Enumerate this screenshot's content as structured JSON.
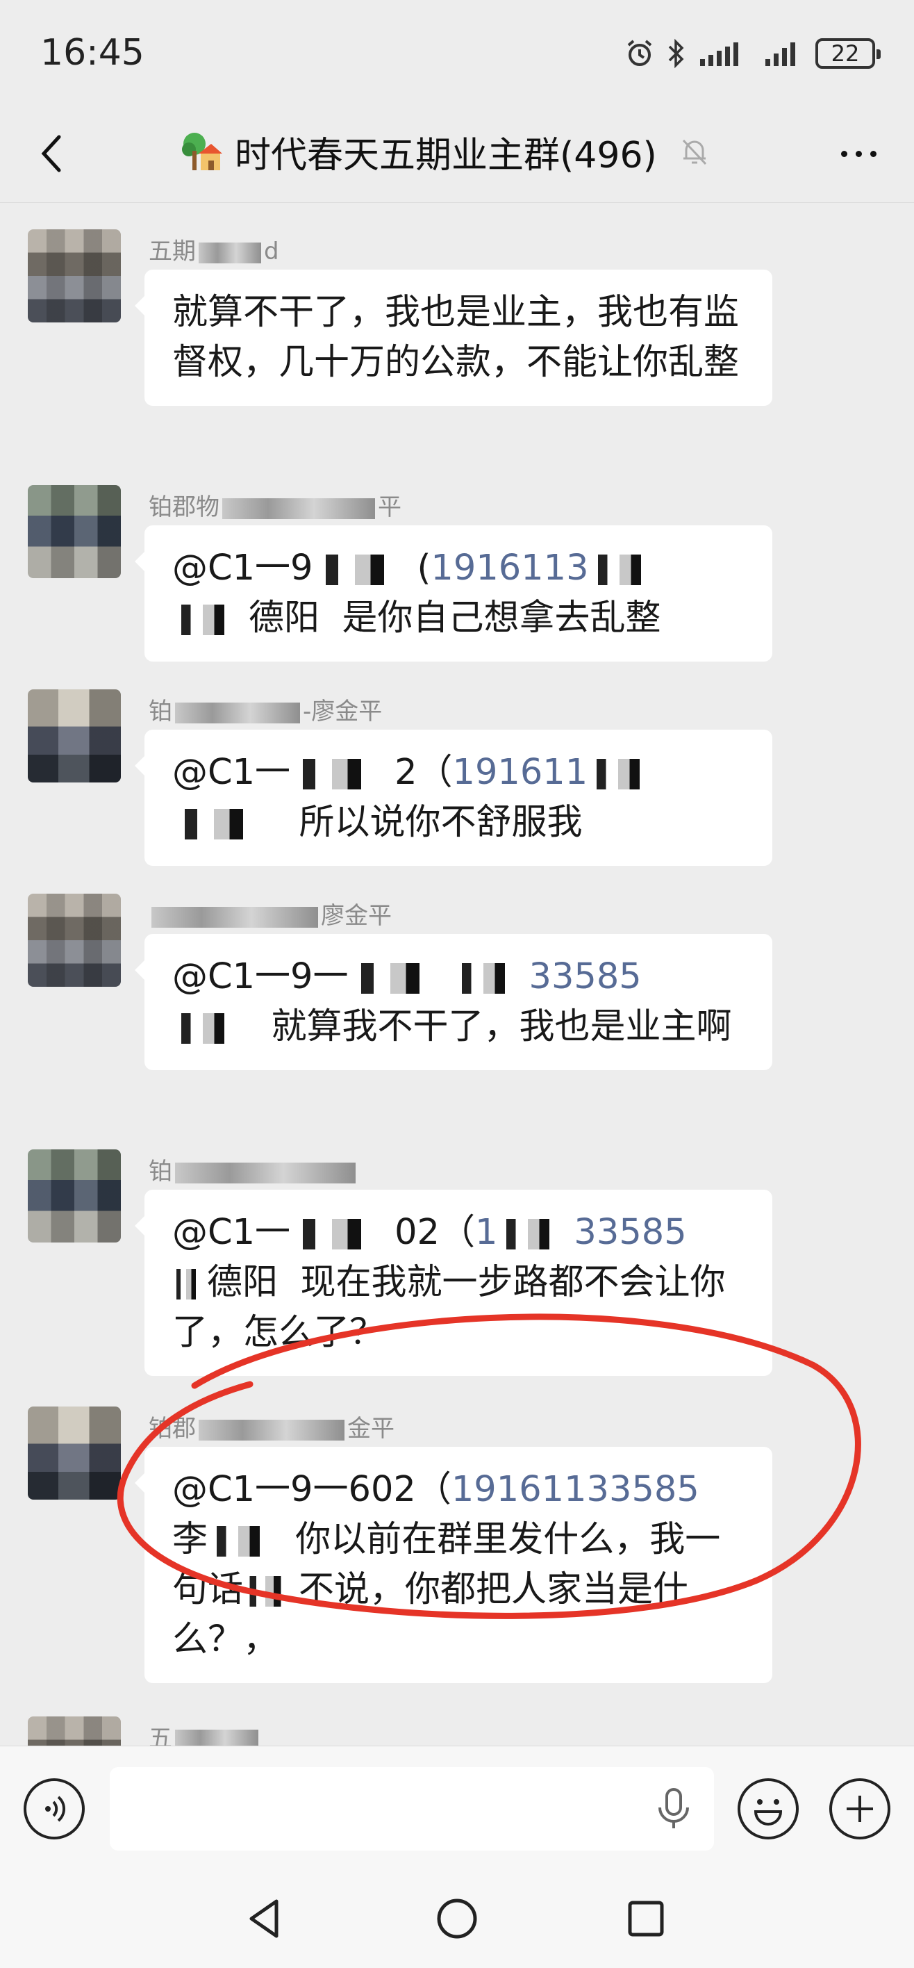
{
  "status_bar": {
    "time": "16:45",
    "battery": "22"
  },
  "header": {
    "title": "时代春天五期业主群(496)"
  },
  "messages": [
    {
      "sender_prefix": "五期",
      "sender_suffix": "d",
      "text": "就算不干了，我也是业主，我也有监督权，几十万的公款，不能让你乱整"
    },
    {
      "sender_prefix": "铂郡物",
      "sender_suffix": "平",
      "mention_prefix": "@C1一9",
      "mention_mid": "(",
      "phone": "1916113",
      "text_tail": "是你自己想拿去乱整",
      "name_tail": "德阳"
    },
    {
      "sender_prefix": "铂",
      "sender_suffix": "-廖金平",
      "mention_prefix": "@C1一",
      "mention_mid": "2（",
      "phone": "191611",
      "text_tail": "所以说你不舒服我"
    },
    {
      "sender_prefix": "",
      "sender_suffix": "廖金平",
      "mention_prefix": "@C1一9一",
      "mention_mid": "",
      "phone": "33585",
      "text_tail": "就算我不干了，我也是业主啊"
    },
    {
      "sender_prefix": "铂",
      "sender_suffix": "",
      "mention_prefix": "@C1一",
      "mention_mid": "02（",
      "phone": "33585",
      "text_tail": "现在我就一步路都不会让你了，怎么了？",
      "name_tail": "德阳",
      "phone_head": "1"
    },
    {
      "sender_prefix": "铂郡",
      "sender_suffix": "金平",
      "mention_prefix": "@C1一9一602（",
      "mention_mid": "",
      "phone": "19161133585",
      "text_tail": "你以前在群里发什么，我一句话",
      "text_tail2": "不说，你都把人家当是什么？，",
      "name_tail": "李"
    },
    {
      "sender_prefix": "五",
      "sender_suffix": ""
    }
  ],
  "colors": {
    "background": "#ededed",
    "bubble": "#ffffff",
    "mention_link": "#576b95",
    "annotation_red": "#e53427"
  }
}
